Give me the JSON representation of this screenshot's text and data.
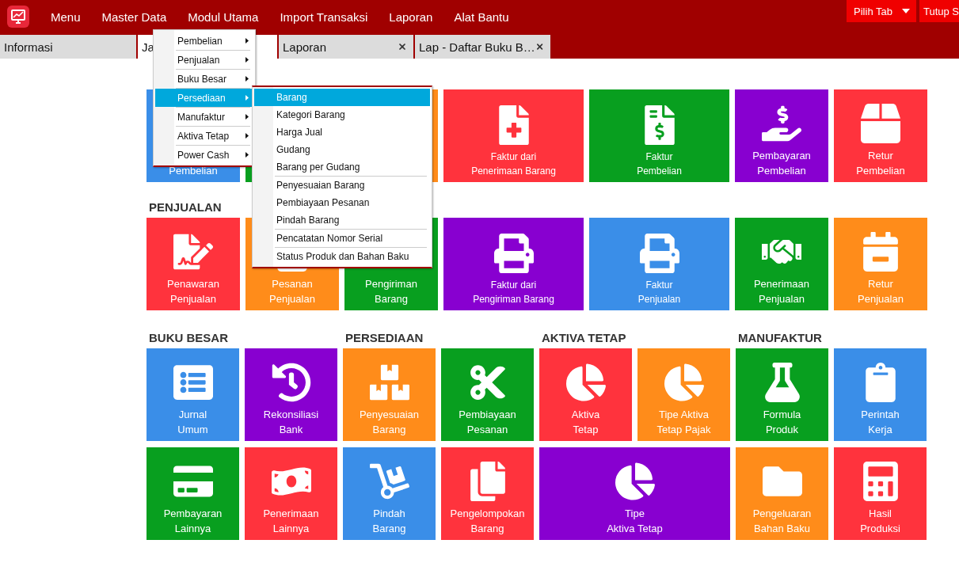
{
  "top_bar": {
    "menu": [
      {
        "label": "Menu"
      },
      {
        "label": "Master Data"
      },
      {
        "label": "Modul Utama"
      },
      {
        "label": "Import Transaksi"
      },
      {
        "label": "Laporan"
      },
      {
        "label": "Alat Bantu"
      }
    ],
    "buttons": [
      {
        "label": "Pilih Tab",
        "kind": "dropdown"
      },
      {
        "label": "Tutup S",
        "kind": "plain"
      }
    ]
  },
  "tabs": [
    {
      "label": "Informasi",
      "selected": false
    },
    {
      "label": "Ja",
      "selected": true
    },
    {
      "label": "Laporan",
      "selected": false,
      "closable": true
    },
    {
      "label": "Lap - Daftar Buku B…",
      "selected": false,
      "closable": true
    }
  ],
  "sections": [
    {
      "kind": "strip",
      "tiles": [
        {
          "lines": [
            "Pembelian"
          ],
          "color": "#3a8ee8",
          "wide": false
        },
        {
          "color": "#089f1f",
          "wide": false
        },
        {
          "color": "#ff8c1a",
          "wide": false
        },
        {
          "lines": [
            "Faktur dari",
            "Penerimaan Barang"
          ],
          "color": "#ff333d",
          "wide": true
        },
        {
          "lines": [
            "Faktur",
            "Pembelian"
          ],
          "color": "#089f1f",
          "wide": true
        },
        {
          "lines": [
            "Pembayaran",
            "Pembelian"
          ],
          "color": "#8800d0",
          "wide": false
        },
        {
          "lines": [
            "Retur",
            "Pembelian"
          ],
          "color": "#ff333d",
          "wide": false
        }
      ]
    },
    {
      "title": "PENJUALAN",
      "kind": "strip",
      "tiles": [
        {
          "lines": [
            "Penawaran",
            "Penjualan"
          ],
          "color": "#ff333d",
          "wide": false
        },
        {
          "lines": [
            "Pesanan",
            "Penjualan"
          ],
          "color": "#ff8c1a",
          "wide": false
        },
        {
          "lines": [
            "Pengiriman",
            "Barang"
          ],
          "color": "#089f1f",
          "wide": false
        },
        {
          "lines": [
            "Faktur dari",
            "Pengiriman Barang"
          ],
          "color": "#8800d0",
          "wide": true
        },
        {
          "lines": [
            "Faktur",
            "Penjualan"
          ],
          "color": "#3a8ee8",
          "wide": true
        },
        {
          "lines": [
            "Penerimaan",
            "Penjualan"
          ],
          "color": "#089f1f",
          "wide": false
        },
        {
          "lines": [
            "Retur",
            "Penjualan"
          ],
          "color": "#ff8c1a",
          "wide": false
        }
      ]
    },
    {
      "title": "BUKU BESAR",
      "kind": "block",
      "tiles": [
        {
          "lines": [
            "Jurnal",
            "Umum"
          ],
          "color": "#3a8ee8",
          "wide": false
        },
        {
          "lines": [
            "Rekonsiliasi",
            "Bank"
          ],
          "color": "#8800d0",
          "wide": false
        },
        {
          "lines": [
            "Pembayaran",
            "Lainnya"
          ],
          "color": "#089f1f",
          "wide": false
        },
        {
          "lines": [
            "Penerimaan",
            "Lainnya"
          ],
          "color": "#ff333d",
          "wide": false
        }
      ]
    },
    {
      "title": "PERSEDIAAN",
      "kind": "block",
      "tiles": [
        {
          "lines": [
            "Penyesuaian",
            "Barang"
          ],
          "color": "#ff8c1a",
          "wide": false
        },
        {
          "lines": [
            "Pembiayaan",
            "Pesanan"
          ],
          "color": "#089f1f",
          "wide": false
        },
        {
          "lines": [
            "Pindah",
            "Barang"
          ],
          "color": "#3a8ee8",
          "wide": false
        },
        {
          "lines": [
            "Pengelompokan",
            "Barang"
          ],
          "color": "#ff333d",
          "wide": false
        }
      ]
    },
    {
      "title": "AKTIVA TETAP",
      "kind": "block",
      "tiles": [
        {
          "lines": [
            "Aktiva",
            "Tetap"
          ],
          "color": "#ff333d",
          "wide": false
        },
        {
          "lines": [
            "Tipe Aktiva",
            "Tetap Pajak"
          ],
          "color": "#ff8c1a",
          "wide": false
        },
        {
          "lines": [
            "Tipe",
            "Aktiva Tetap"
          ],
          "color": "#8800d0",
          "wide": true
        }
      ]
    },
    {
      "title": "MANUFAKTUR",
      "kind": "block",
      "tiles": [
        {
          "lines": [
            "Formula",
            "Produk"
          ],
          "color": "#089f1f",
          "wide": false
        },
        {
          "lines": [
            "Perintah",
            "Kerja"
          ],
          "color": "#3a8ee8",
          "wide": false
        },
        {
          "lines": [
            "Pengeluaran",
            "Bahan Baku"
          ],
          "color": "#ff8c1a",
          "wide": false
        },
        {
          "lines": [
            "Hasil",
            "Produksi"
          ],
          "color": "#ff333d",
          "wide": false
        }
      ]
    }
  ],
  "dropdown": {
    "items": [
      {
        "label": "Pembelian",
        "selected": false,
        "submenu": true
      },
      {
        "label": "Penjualan",
        "selected": false,
        "submenu": true
      },
      {
        "label": "Buku Besar",
        "selected": false,
        "submenu": true
      },
      {
        "label": "Persediaan",
        "selected": true,
        "submenu": true
      },
      {
        "label": "Manufaktur",
        "selected": false,
        "submenu": true
      },
      {
        "label": "Aktiva Tetap",
        "selected": false,
        "submenu": true
      },
      {
        "label": "Power Cash",
        "selected": false,
        "submenu": true
      }
    ],
    "submenu": [
      {
        "label": "Barang",
        "selected": true
      },
      {
        "label": "Kategori Barang",
        "selected": false
      },
      {
        "label": "Harga Jual",
        "selected": false
      },
      {
        "label": "Gudang",
        "selected": false
      },
      {
        "label": "Barang per Gudang",
        "selected": false,
        "separator_after": true
      },
      {
        "label": "Penyesuaian Barang",
        "selected": false
      },
      {
        "label": "Pembiayaan Pesanan",
        "selected": false
      },
      {
        "label": "Pindah Barang",
        "selected": false,
        "separator_after": true
      },
      {
        "label": "Pencatatan Nomor Serial",
        "selected": false,
        "separator_after": true
      },
      {
        "label": "Status Produk dan Bahan Baku",
        "selected": false
      }
    ]
  }
}
